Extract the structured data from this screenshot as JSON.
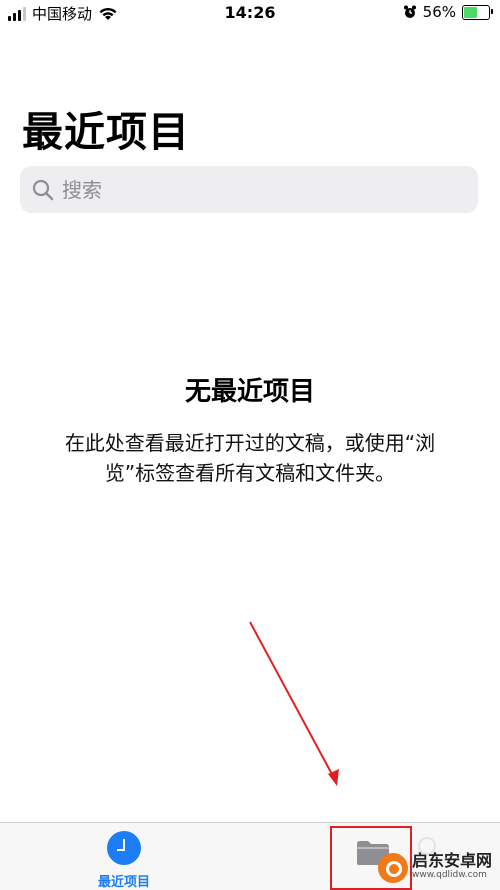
{
  "status_bar": {
    "carrier": "中国移动",
    "time": "14:26",
    "battery_percent": "56%",
    "battery_level": 0.56,
    "icons": [
      "signal-icon",
      "wifi-icon",
      "alarm-icon",
      "battery-icon"
    ]
  },
  "page": {
    "title": "最近项目"
  },
  "search": {
    "placeholder": "搜索",
    "value": ""
  },
  "empty_state": {
    "title": "无最近项目",
    "description": "在此处查看最近打开过的文稿，或使用“浏览”标签查看所有文稿和文件夹。"
  },
  "tab_bar": {
    "tabs": [
      {
        "label": "最近项目",
        "icon": "clock-icon",
        "active": true
      },
      {
        "label": "",
        "icon": "folder-icon",
        "active": false
      }
    ],
    "active_color": "#1d7df5"
  },
  "annotation": {
    "color": "#e02020"
  },
  "watermark": {
    "title": "启东安卓网",
    "url": "www.qdlidw.com"
  }
}
